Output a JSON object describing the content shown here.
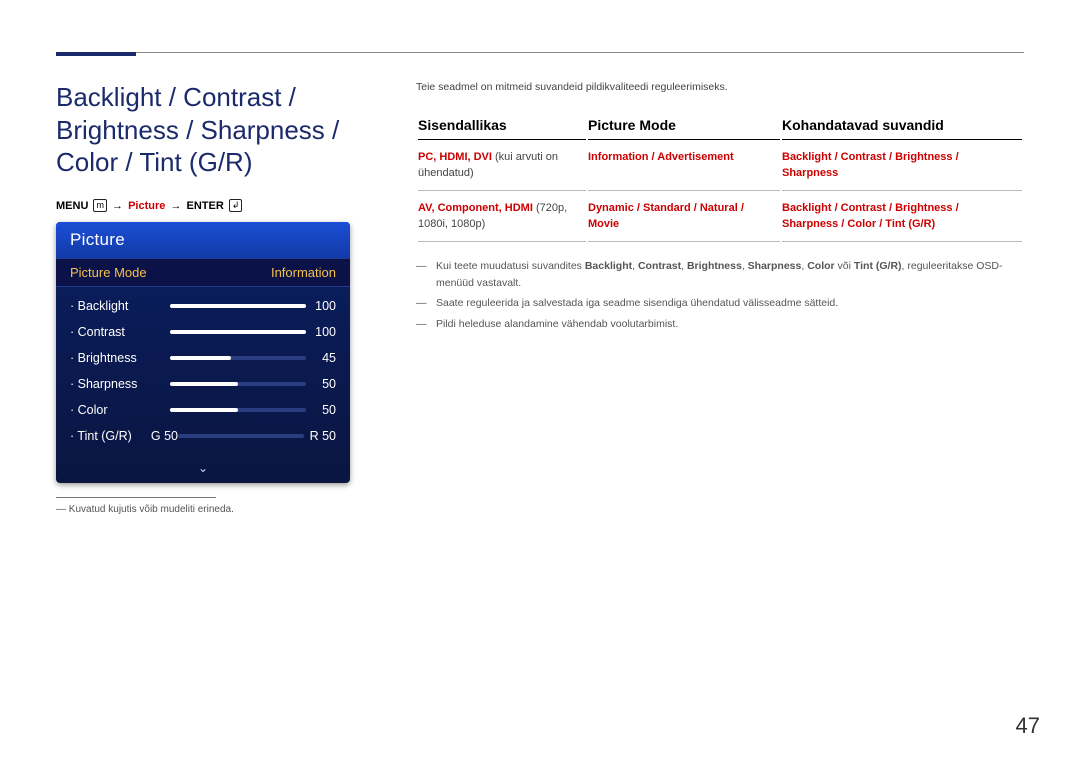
{
  "main_title": "Backlight / Contrast / Brightness / Sharpness / Color / Tint (G/R)",
  "menu_path": {
    "menu": "MENU",
    "picture": "Picture",
    "enter": "ENTER"
  },
  "osd": {
    "title": "Picture",
    "mode_label": "Picture Mode",
    "mode_value": "Information",
    "rows": [
      {
        "label": "Backlight",
        "value": "100",
        "pct": 100
      },
      {
        "label": "Contrast",
        "value": "100",
        "pct": 100
      },
      {
        "label": "Brightness",
        "value": "45",
        "pct": 45
      },
      {
        "label": "Sharpness",
        "value": "50",
        "pct": 50
      },
      {
        "label": "Color",
        "value": "50",
        "pct": 50
      }
    ],
    "tint": {
      "label": "Tint (G/R)",
      "g": "G 50",
      "r": "R 50"
    }
  },
  "left_note": "Kuvatud kujutis võib mudeliti erineda.",
  "intro": "Teie seadmel on mitmeid suvandeid pildikvaliteedi reguleerimiseks.",
  "table": {
    "headers": [
      "Sisendallikas",
      "Picture Mode",
      "Kohandatavad suvandid"
    ],
    "rows": [
      {
        "c1": {
          "red": "PC, HDMI, DVI",
          "plain": " (kui arvuti on ühendatud)"
        },
        "c2": {
          "red": "Information / Advertisement"
        },
        "c3": {
          "red": "Backlight / Contrast / Brightness / Sharpness"
        }
      },
      {
        "c1": {
          "red": "AV, Component, HDMI",
          "plain": " (720p, 1080i, 1080p)"
        },
        "c2": {
          "red": "Dynamic / Standard / Natural / Movie"
        },
        "c3": {
          "red": "Backlight / Contrast / Brightness / Sharpness / Color / Tint (G/R)"
        }
      }
    ]
  },
  "notes_list": [
    "Kui teete muudatusi suvandites Backlight, Contrast, Brightness, Sharpness, Color või Tint (G/R), reguleeritakse OSD-menüüd vastavalt.",
    "Saate reguleerida ja salvestada iga seadme sisendiga ühendatud välisseadme sätteid.",
    "Pildi heleduse alandamine vähendab voolutarbimist."
  ],
  "notes_highlights": [
    "Backlight",
    "Contrast",
    "Brightness",
    "Sharpness",
    "Color",
    "Tint (G/R)"
  ],
  "page_num": "47"
}
